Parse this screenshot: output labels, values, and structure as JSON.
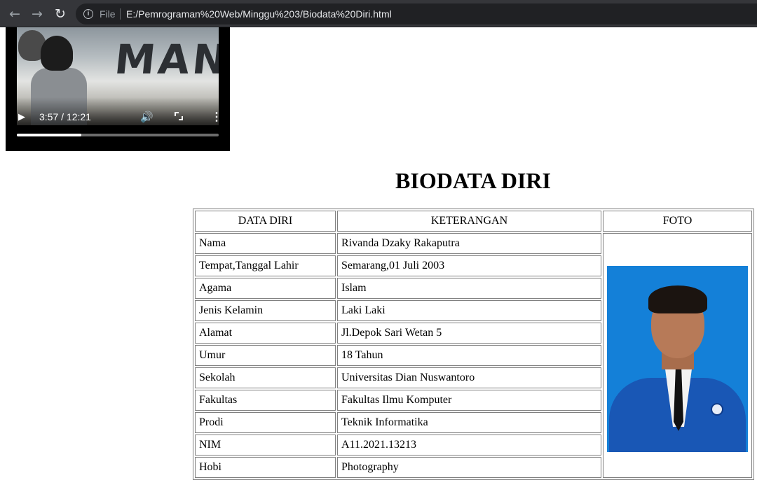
{
  "browser": {
    "nav_back_icon": "arrow-left-icon",
    "nav_forward_icon": "arrow-right-icon",
    "reload_icon": "reload-icon",
    "info_icon": "info-icon",
    "scheme_label": "File",
    "url": "E:/Pemrograman%20Web/Minggu%203/Biodata%20Diri.html"
  },
  "video": {
    "current_time": "3:57",
    "duration": "12:21",
    "time_display": "3:57 / 12:21",
    "progress_fraction": 0.32,
    "frame_text": "MAN"
  },
  "page": {
    "title": "BIODATA DIRI",
    "table": {
      "headers": [
        "DATA DIRI",
        "KETERANGAN",
        "FOTO"
      ],
      "rows": [
        {
          "label": "Nama",
          "value": "Rivanda Dzaky Rakaputra"
        },
        {
          "label": "Tempat,Tanggal Lahir",
          "value": "Semarang,01 Juli 2003"
        },
        {
          "label": "Agama",
          "value": "Islam"
        },
        {
          "label": "Jenis Kelamin",
          "value": "Laki Laki"
        },
        {
          "label": "Alamat",
          "value": "Jl.Depok Sari Wetan 5"
        },
        {
          "label": "Umur",
          "value": "18 Tahun"
        },
        {
          "label": "Sekolah",
          "value": "Universitas Dian Nuswantoro"
        },
        {
          "label": "Fakultas",
          "value": "Fakultas Ilmu Komputer"
        },
        {
          "label": "Prodi",
          "value": "Teknik Informatika"
        },
        {
          "label": "NIM",
          "value": "A11.2021.13213"
        },
        {
          "label": "Hobi",
          "value": "Photography"
        }
      ]
    }
  },
  "colors": {
    "toolbar": "#35363a",
    "omnibox": "#202124",
    "photo_background": "#1480d8",
    "jacket": "#1957b5"
  }
}
